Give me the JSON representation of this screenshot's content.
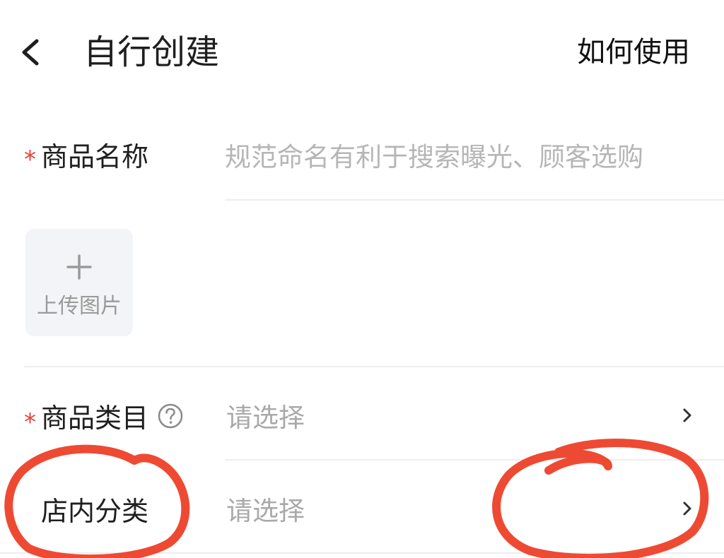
{
  "header": {
    "title": "自行创建",
    "help_link": "如何使用"
  },
  "form": {
    "product_name": {
      "label": "商品名称",
      "required": true,
      "placeholder": "规范命名有利于搜索曝光、顾客选购",
      "value": ""
    },
    "image_upload": {
      "label": "上传图片"
    },
    "category": {
      "label": "商品类目",
      "required": true,
      "value": "请选择"
    },
    "store_category": {
      "label": "店内分类",
      "required": false,
      "value": "请选择"
    }
  },
  "colors": {
    "required_star": "#e0443a",
    "annotation": "#ee4a33",
    "placeholder": "#b6b6b6"
  },
  "icons": {
    "back": "chevron-left-icon",
    "add": "plus-icon",
    "help": "question-circle-icon",
    "forward": "chevron-right-icon"
  }
}
